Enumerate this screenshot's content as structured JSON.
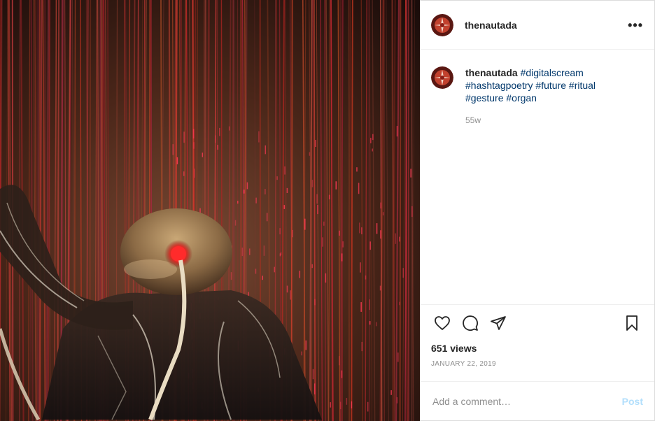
{
  "post": {
    "username": "thenautada",
    "caption_tags": [
      "#digitalscream",
      "#hashtagpoetry",
      "#future",
      "#ritual",
      "#gesture",
      "#organ"
    ],
    "age": "55w",
    "views": "651 views",
    "date": "JANUARY 22, 2019"
  },
  "icons": {
    "more": "more-options-icon",
    "like": "heart-icon",
    "comment": "comment-icon",
    "share": "paper-plane-icon",
    "save": "bookmark-icon"
  },
  "comment_box": {
    "placeholder": "Add a comment…",
    "post_label": "Post"
  },
  "colors": {
    "hashtag": "#00376b",
    "post_button": "#b2dffc",
    "muted": "#8e8e8e"
  }
}
